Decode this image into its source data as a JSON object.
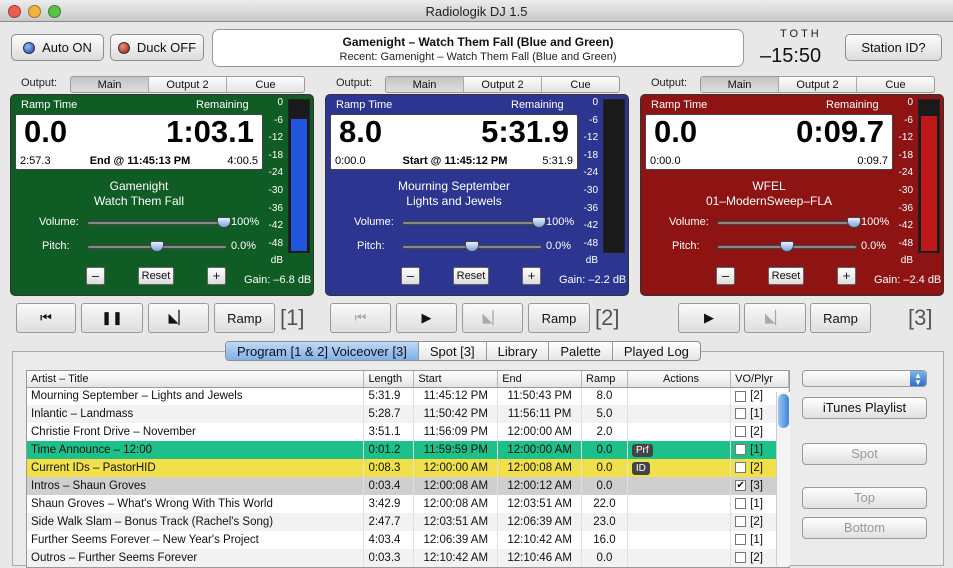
{
  "window": {
    "title": "Radiologik DJ 1.5"
  },
  "toolbar": {
    "auto_label": "Auto ON",
    "duck_label": "Duck OFF",
    "station_label": "Station ID?"
  },
  "nowplaying": {
    "current": "Gamenight – Watch Them Fall (Blue and Green)",
    "recent": "Recent: Gamenight – Watch Them Fall (Blue and Green)"
  },
  "toth": {
    "label": "TOTH",
    "value": "–15:50"
  },
  "outputs": {
    "label": "Output:",
    "tabs": [
      "Main",
      "Output 2",
      "Cue"
    ]
  },
  "deck_header": {
    "ramp": "Ramp Time",
    "remaining": "Remaining"
  },
  "scale": [
    "0",
    "-6",
    "-12",
    "-18",
    "-24",
    "-30",
    "-36",
    "-42",
    "-48",
    "dB"
  ],
  "controls": {
    "volume": "Volume:",
    "pitch": "Pitch:",
    "minus": "–",
    "plus": "+",
    "reset": "Reset"
  },
  "decks": [
    {
      "color": "#0f5c24",
      "ramp": "0.0",
      "remaining": "1:03.1",
      "left": "2:57.3",
      "mid": "End @ 11:45:13 PM",
      "right": "4:00.5",
      "line1": "Gamenight",
      "line2": "Watch Them Fall",
      "vol": "100%",
      "pitch": "0.0%",
      "gain": "Gain: –6.8 dB",
      "meter_level": 0.88,
      "meter_color": "#2255dd",
      "vol_frac": 0.98,
      "pitch_frac": 0.5
    },
    {
      "color": "#2c3690",
      "ramp": "8.0",
      "remaining": "5:31.9",
      "left": "0:00.0",
      "mid": "Start @ 11:45:12 PM",
      "right": "5:31.9",
      "line1": "Mourning September",
      "line2": "Lights and Jewels",
      "vol": "100%",
      "pitch": "0.0%",
      "gain": "Gain: –2.2 dB",
      "meter_level": 0,
      "meter_color": "#2255dd",
      "vol_frac": 0.98,
      "pitch_frac": 0.5
    },
    {
      "color": "#8e1414",
      "ramp": "0.0",
      "remaining": "0:09.7",
      "left": "0:00.0",
      "mid": "",
      "right": "0:09.7",
      "line1": "WFEL",
      "line2": "01–ModernSweep–FLA",
      "vol": "100%",
      "pitch": "0.0%",
      "gain": "Gain: –2.4 dB",
      "meter_level": 0.9,
      "meter_color": "#c01818",
      "vol_frac": 0.98,
      "pitch_frac": 0.5
    }
  ],
  "transport": {
    "ramp": "Ramp",
    "n1": "[1]",
    "n2": "[2]",
    "n3": "[3]"
  },
  "tabs": [
    "Program [1 & 2] Voiceover [3]",
    "Spot [3]",
    "Library",
    "Palette",
    "Played Log"
  ],
  "table": {
    "headers": [
      "Artist – Title",
      "Length",
      "Start",
      "End",
      "Ramp",
      "Actions",
      "VO/Plyr"
    ],
    "rows": [
      {
        "title": "Mourning September – Lights and Jewels",
        "length": "5:31.9",
        "start": "11:45:12 PM",
        "end": "11:50:43 PM",
        "ramp": "8.0",
        "action": "",
        "checked": "",
        "plyr": "[2]",
        "bg": ""
      },
      {
        "title": "Inlantic – Landmass",
        "length": "5:28.7",
        "start": "11:50:42 PM",
        "end": "11:56:11 PM",
        "ramp": "5.0",
        "action": "",
        "checked": "",
        "plyr": "[1]",
        "bg": ""
      },
      {
        "title": "Christie Front Drive – November",
        "length": "3:51.1",
        "start": "11:56:09 PM",
        "end": "12:00:00 AM",
        "ramp": "2.0",
        "action": "",
        "checked": "",
        "plyr": "[2]",
        "bg": ""
      },
      {
        "title": "Time Announce – 12:00",
        "length": "0:01.2",
        "start": "11:59:59 PM",
        "end": "12:00:00 AM",
        "ramp": "0.0",
        "action": "Prf",
        "checked": "",
        "plyr": "[1]",
        "bg": "#1ec08a"
      },
      {
        "title": "Current IDs – PastorHID",
        "length": "0:08.3",
        "start": "12:00:00 AM",
        "end": "12:00:08 AM",
        "ramp": "0.0",
        "action": "ID",
        "checked": "",
        "plyr": "[2]",
        "bg": "#f2e04a"
      },
      {
        "title": "Intros – Shaun Groves",
        "length": "0:03.4",
        "start": "12:00:08 AM",
        "end": "12:00:12 AM",
        "ramp": "0.0",
        "action": "",
        "checked": "✔",
        "plyr": "[3]",
        "bg": "#cfcfcf"
      },
      {
        "title": "Shaun Groves – What's Wrong With This World",
        "length": "3:42.9",
        "start": "12:00:08 AM",
        "end": "12:03:51 AM",
        "ramp": "22.0",
        "action": "",
        "checked": "",
        "plyr": "[1]",
        "bg": ""
      },
      {
        "title": "Side Walk Slam – Bonus Track  (Rachel's Song)",
        "length": "2:47.7",
        "start": "12:03:51 AM",
        "end": "12:06:39 AM",
        "ramp": "23.0",
        "action": "",
        "checked": "",
        "plyr": "[2]",
        "bg": ""
      },
      {
        "title": "Further Seems Forever – New Year's Project",
        "length": "4:03.4",
        "start": "12:06:39 AM",
        "end": "12:10:42 AM",
        "ramp": "16.0",
        "action": "",
        "checked": "",
        "plyr": "[1]",
        "bg": ""
      },
      {
        "title": "Outros – Further Seems Forever",
        "length": "0:03.3",
        "start": "12:10:42 AM",
        "end": "12:10:46 AM",
        "ramp": "0.0",
        "action": "",
        "checked": "",
        "plyr": "[2]",
        "bg": ""
      }
    ]
  },
  "side": {
    "itunes": "iTunes Playlist",
    "spot": "Spot",
    "top": "Top",
    "bottom": "Bottom"
  }
}
